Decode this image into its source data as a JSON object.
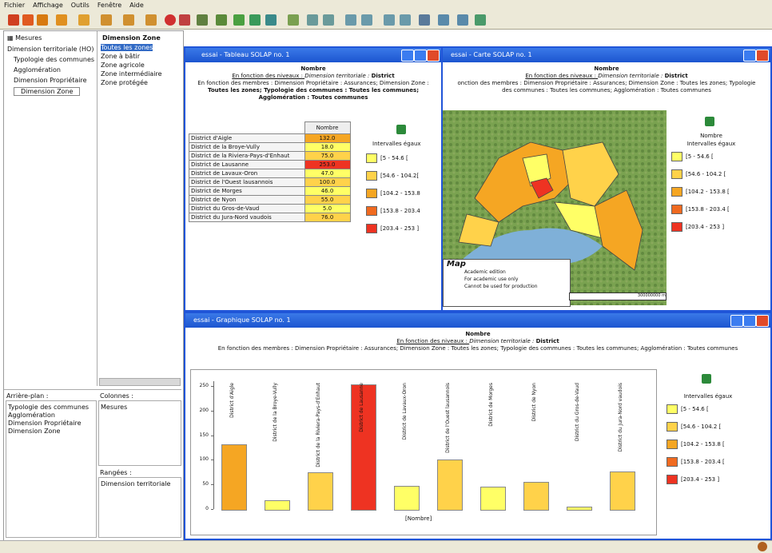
{
  "menu": [
    "Fichier",
    "Affichage",
    "Outils",
    "Fenêtre",
    "Aide"
  ],
  "left": {
    "measures_label": "Mesures",
    "dimension_tree": [
      "Dimension territoriale (HO)",
      "Typologie des communes",
      "Agglomération",
      "Dimension Propriétaire",
      "Dimension Zone"
    ],
    "zone_header": "Dimension Zone",
    "zone_items": [
      "Toutes les zones",
      "Zone à bâtir",
      "Zone agricole",
      "Zone intermédiaire",
      "Zone protégée"
    ],
    "background_label": "Arrière-plan :",
    "background_items": [
      "Typologie des communes",
      "Agglomération",
      "Dimension Propriétaire",
      "Dimension Zone"
    ],
    "columns_label": "Colonnes :",
    "columns_items": [
      "Mesures"
    ],
    "rows_label": "Rangées :",
    "rows_items": [
      "Dimension territoriale"
    ]
  },
  "table_window": {
    "title": "essai - Tableau SOLAP no. 1",
    "h_title": "Nombre",
    "h_line1_pre": "En fonction des niveaux : ",
    "h_line1_dim": "Dimension territoriale : ",
    "h_line1_val": "District",
    "h_line2": "En fonction des membres : Dimension Propriétaire : Assurances; Dimension Zone :",
    "h_line3": "Toutes les zones; Typologie des communes : Toutes les communes;",
    "h_line4": "Agglomération : Toutes communes",
    "col_header": "Nombre",
    "rows": [
      {
        "name": "District d'Aigle",
        "value": "132.0",
        "color": "#f5a623"
      },
      {
        "name": "District de la Broye-Vully",
        "value": "18.0",
        "color": "#ffff66"
      },
      {
        "name": "District de la Riviera-Pays-d'Enhaut",
        "value": "75.0",
        "color": "#ffd24a"
      },
      {
        "name": "District de Lausanne",
        "value": "253.0",
        "color": "#ee3322"
      },
      {
        "name": "District de Lavaux-Oron",
        "value": "47.0",
        "color": "#ffff66"
      },
      {
        "name": "District de l'Ouest lausannois",
        "value": "100.0",
        "color": "#ffd24a"
      },
      {
        "name": "District de Morges",
        "value": "46.0",
        "color": "#ffff66"
      },
      {
        "name": "District de Nyon",
        "value": "55.0",
        "color": "#ffd24a"
      },
      {
        "name": "District du Gros-de-Vaud",
        "value": "5.0",
        "color": "#ffff66"
      },
      {
        "name": "District du Jura-Nord vaudois",
        "value": "76.0",
        "color": "#ffd24a"
      }
    ]
  },
  "legend": {
    "title": "Nombre",
    "subtitle": "Intervalles égaux",
    "items": [
      {
        "label": "[5 - 54.6 [",
        "color": "#ffff66"
      },
      {
        "label": "[54.6 - 104.2 [",
        "color": "#ffd24a"
      },
      {
        "label": "[104.2 - 153.8 [",
        "color": "#f5a623"
      },
      {
        "label": "[153.8 - 203.4 [",
        "color": "#f06a20"
      },
      {
        "label": "[203.4 - 253 ]",
        "color": "#ee3322"
      }
    ],
    "table_items": [
      "[5 - 54.6 [",
      "[54.6 - 104.2[",
      "[104.2 - 153.8",
      "[153.8 - 203.4",
      "[203.4 - 253 ]"
    ]
  },
  "map_window": {
    "title": "essai - Carte SOLAP no. 1",
    "h_title": "Nombre",
    "h_line1_pre": "En fonction des niveaux : ",
    "h_line1_dim": "Dimension territoriale : ",
    "h_line1_val": "District",
    "h_line2": "onction des membres : Dimension Propriétaire : Assurances; Dimension Zone : Toutes les zones; Typologie",
    "h_line3": "des communes : Toutes les communes; Agglomération : Toutes communes",
    "watermark_brand": "Map",
    "watermark_lines": [
      "Academic edition",
      "For academic use only",
      "Cannot be used for production"
    ],
    "scale": "300000000 m"
  },
  "chart_window": {
    "title": "essai - Graphique SOLAP no. 1",
    "h_title": "Nombre",
    "h_line1_pre": "En fonction des niveaux : ",
    "h_line1_dim": "Dimension territoriale : ",
    "h_line1_val": "District",
    "h_line2": "En fonction des membres : Dimension Propriétaire : Assurances; Dimension Zone : Toutes les zones; Typologie des communes : Toutes les communes; Agglomération : Toutes communes",
    "xlabel": "[Nombre]"
  },
  "chart_data": {
    "type": "bar",
    "categories": [
      "District d'Aigle",
      "District de la Broye-Vully",
      "District de la Riviera-Pays-d'Enhaut",
      "District de Lausanne",
      "District de Lavaux-Oron",
      "District de l'Ouest lausannois",
      "District de Morges",
      "District de Nyon",
      "District du Gros-de-Vaud",
      "District du Jura-Nord vaudois"
    ],
    "values": [
      132,
      18,
      75,
      253,
      47,
      100,
      46,
      55,
      5,
      76
    ],
    "colors": [
      "#f5a623",
      "#ffff66",
      "#ffd24a",
      "#ee3322",
      "#ffff66",
      "#ffd24a",
      "#ffff66",
      "#ffd24a",
      "#ffff66",
      "#ffd24a"
    ],
    "yticks": [
      "250",
      "200",
      "150",
      "100",
      "50",
      "0"
    ],
    "ylim": [
      0,
      260
    ],
    "xlabel": "[Nombre]",
    "ylabel": ""
  }
}
